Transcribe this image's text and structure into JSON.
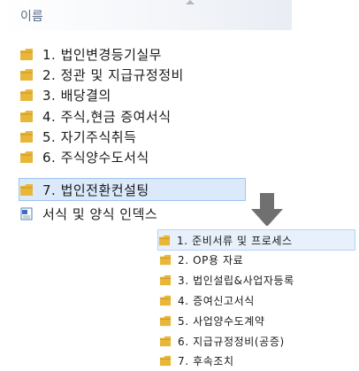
{
  "header": {
    "label": "이름"
  },
  "colors": {
    "folder": "#e8b73a",
    "selection": "#dbe9fb",
    "arrow": "#707070"
  },
  "main_items": [
    {
      "label": "1. 법인변경등기실무",
      "icon": "folder-icon"
    },
    {
      "label": "2. 정관 및 지급규정정비",
      "icon": "folder-icon"
    },
    {
      "label": "3. 배당결의",
      "icon": "folder-icon"
    },
    {
      "label": "4. 주식,현금 증여서식",
      "icon": "folder-icon"
    },
    {
      "label": "5. 자기주식취득",
      "icon": "folder-icon"
    },
    {
      "label": "6. 주식양수도서식",
      "icon": "folder-icon"
    },
    {
      "label": "7. 법인전환컨설팅",
      "icon": "folder-icon",
      "selected": true
    },
    {
      "label": "서식 및 양식 인덱스",
      "icon": "document-icon"
    }
  ],
  "sub_items": [
    {
      "label": "1. 준비서류 및 프로세스",
      "selected": true
    },
    {
      "label": "2. OP용 자료"
    },
    {
      "label": "3. 법인설립&사업자등록"
    },
    {
      "label": "4. 증여신고서식"
    },
    {
      "label": "5. 사업양수도계약"
    },
    {
      "label": "6. 지급규정정비(공증)"
    },
    {
      "label": "7. 후속조치"
    }
  ]
}
